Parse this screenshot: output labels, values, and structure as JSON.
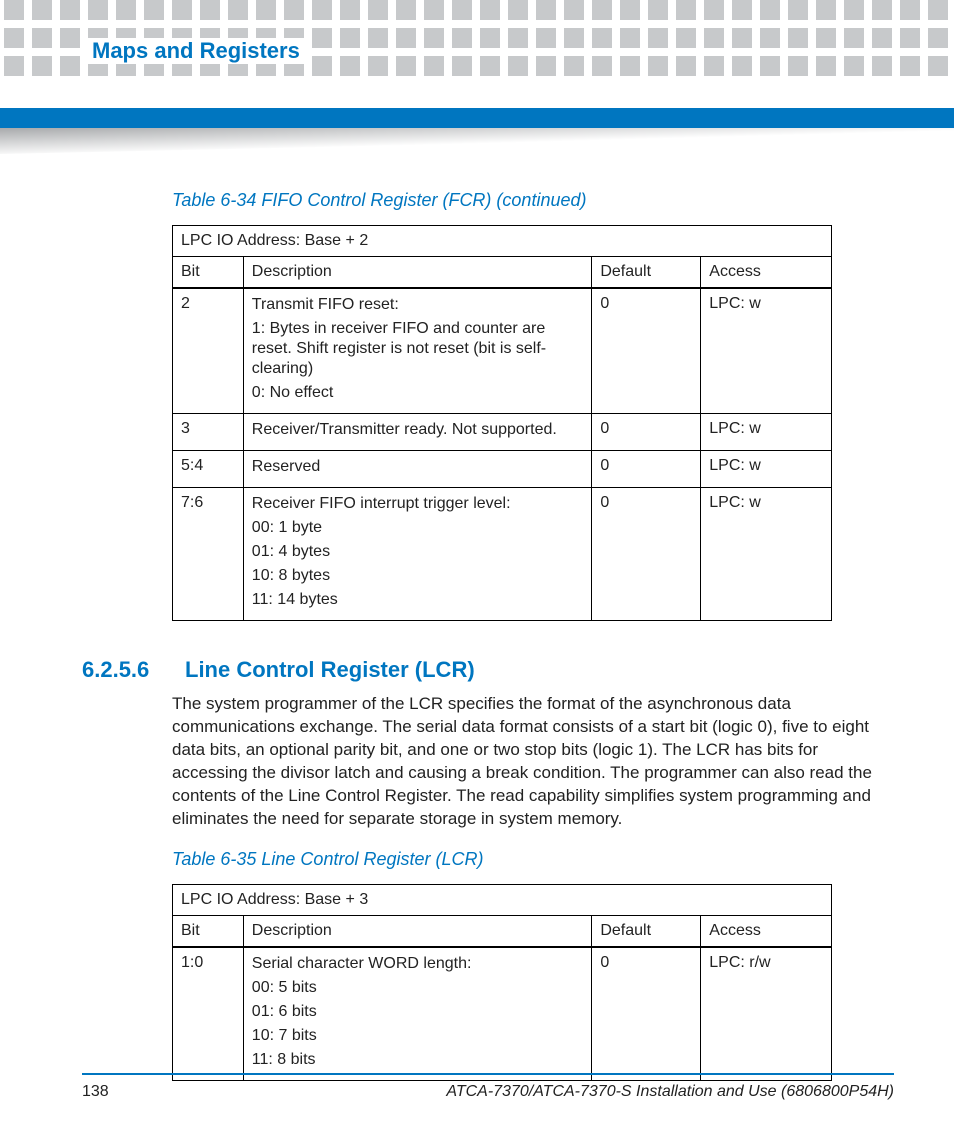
{
  "header": {
    "running_title": "Maps and Registers"
  },
  "table1": {
    "caption": "Table 6-34 FIFO Control Register (FCR)  (continued)",
    "address_line": "LPC IO Address: Base + 2",
    "columns": {
      "c1": "Bit",
      "c2": "Description",
      "c3": "Default",
      "c4": "Access"
    },
    "rows": [
      {
        "bit": "2",
        "desc_l1": "Transmit FIFO reset:",
        "desc_l2": "1: Bytes in receiver FIFO and counter are reset. Shift register is not reset (bit is self-clearing)",
        "desc_l3": "0: No effect",
        "default": "0",
        "access": "LPC: w"
      },
      {
        "bit": "3",
        "desc_l1": "Receiver/Transmitter ready. Not supported.",
        "default": "0",
        "access": "LPC: w"
      },
      {
        "bit": "5:4",
        "desc_l1": "Reserved",
        "default": "0",
        "access": "LPC: w"
      },
      {
        "bit": "7:6",
        "desc_l1": "Receiver FIFO interrupt trigger level:",
        "desc_l2": "00: 1 byte",
        "desc_l3": "01: 4 bytes",
        "desc_l4": "10: 8 bytes",
        "desc_l5": "11: 14 bytes",
        "default": "0",
        "access": "LPC: w"
      }
    ]
  },
  "section": {
    "number": "6.2.5.6",
    "title": "Line Control Register (LCR)",
    "paragraph": "The system programmer of the LCR specifies the format of the asynchronous data communications exchange. The serial data format consists of a start bit (logic 0), five to eight data bits, an optional parity bit, and one or two stop bits (logic 1). The LCR has bits for accessing the divisor latch and causing a break condition. The programmer can also read the contents of the Line Control Register. The read capability simplifies system programming and eliminates the need for separate storage in system memory."
  },
  "table2": {
    "caption": "Table 6-35 Line Control Register (LCR)",
    "address_line": "LPC IO Address: Base + 3",
    "columns": {
      "c1": "Bit",
      "c2": "Description",
      "c3": "Default",
      "c4": "Access"
    },
    "rows": [
      {
        "bit": "1:0",
        "desc_l1": "Serial character WORD length:",
        "desc_l2": "00: 5 bits",
        "desc_l3": "01: 6 bits",
        "desc_l4": "10: 7 bits",
        "desc_l5": "11: 8 bits",
        "default": "0",
        "access": "LPC: r/w"
      }
    ]
  },
  "footer": {
    "page_number": "138",
    "doc_title": "ATCA-7370/ATCA-7370-S Installation and Use (6806800P54H)"
  }
}
